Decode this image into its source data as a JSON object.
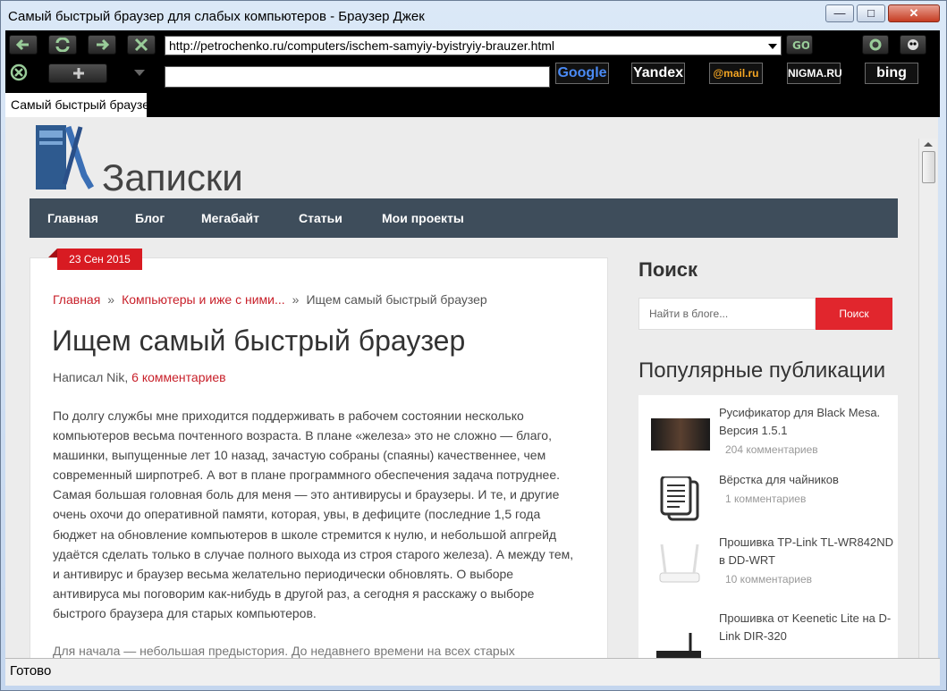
{
  "window": {
    "title": "Самый быстрый браузер для слабых компьютеров - Браузер Джек",
    "minimize": "—",
    "maximize": "□",
    "close": "✕"
  },
  "toolbar": {
    "url": "http://petrochenko.ru/computers/ischem-samyiy-byistryiy-brauzer.html",
    "search_value": "",
    "engines": [
      "Google",
      "Yandex",
      "@mail.ru",
      "NIGMA.RU",
      "bing"
    ],
    "tab_label": "Самый быстрый браузер для слабых компьютеров"
  },
  "site": {
    "name": "Записки",
    "nav": [
      "Главная",
      "Блог",
      "Мегабайт",
      "Статьи",
      "Мои проекты"
    ]
  },
  "post": {
    "date": "23 Сен 2015",
    "breadcrumbs": [
      "Главная",
      "Компьютеры и иже с ними...",
      "Ищем самый быстрый браузер"
    ],
    "title": "Ищем самый быстрый браузер",
    "author_prefix": "Написал Nik,",
    "comments_link": "6 комментариев",
    "body": "По долгу службы мне приходится поддерживать в рабочем состоянии несколько компьютеров весьма почтенного возраста. В плане «железа» это не сложно — благо, машинки, выпущенные лет 10 назад, зачастую собраны (спаяны) качественнее, чем современный ширпотреб. А вот в плане программного обеспечения задача потруднее. Самая большая головная боль для меня — это антивирусы и браузеры. И те, и другие очень охочи до оперативной памяти, которая, увы, в дефиците (последние 1,5 года бюджет на обновление компьютеров в школе стремится к нулю, и небольшой апгрейд удаётся сделать только в случае полного выхода из строя старого железа). А между тем, и антивирус и браузер весьма желательно периодически обновлять. О выборе антивируса мы поговорим как-нибудь в другой раз, а сегодня я расскажу о выборе быстрого браузера для старых компьютеров.",
    "next_line": "Для начала — небольшая предыстория. До недавнего времени на всех старых"
  },
  "sidebar": {
    "search_heading": "Поиск",
    "search_placeholder": "Найти в блоге...",
    "search_button": "Поиск",
    "popular_heading": "Популярные публикации",
    "items": [
      {
        "title": "Русификатор для Black Mesa. Версия 1.5.1",
        "count": "204 комментариев"
      },
      {
        "title": "Вёрстка для чайников",
        "count": "1 комментариев"
      },
      {
        "title": "Прошивка TP-Link TL-WR842ND в DD-WRT",
        "count": "10 комментариев"
      },
      {
        "title": "Прошивка от Keenetic Lite на D-Link DIR-320",
        "count": ""
      }
    ]
  },
  "status": {
    "text": "Готово"
  }
}
